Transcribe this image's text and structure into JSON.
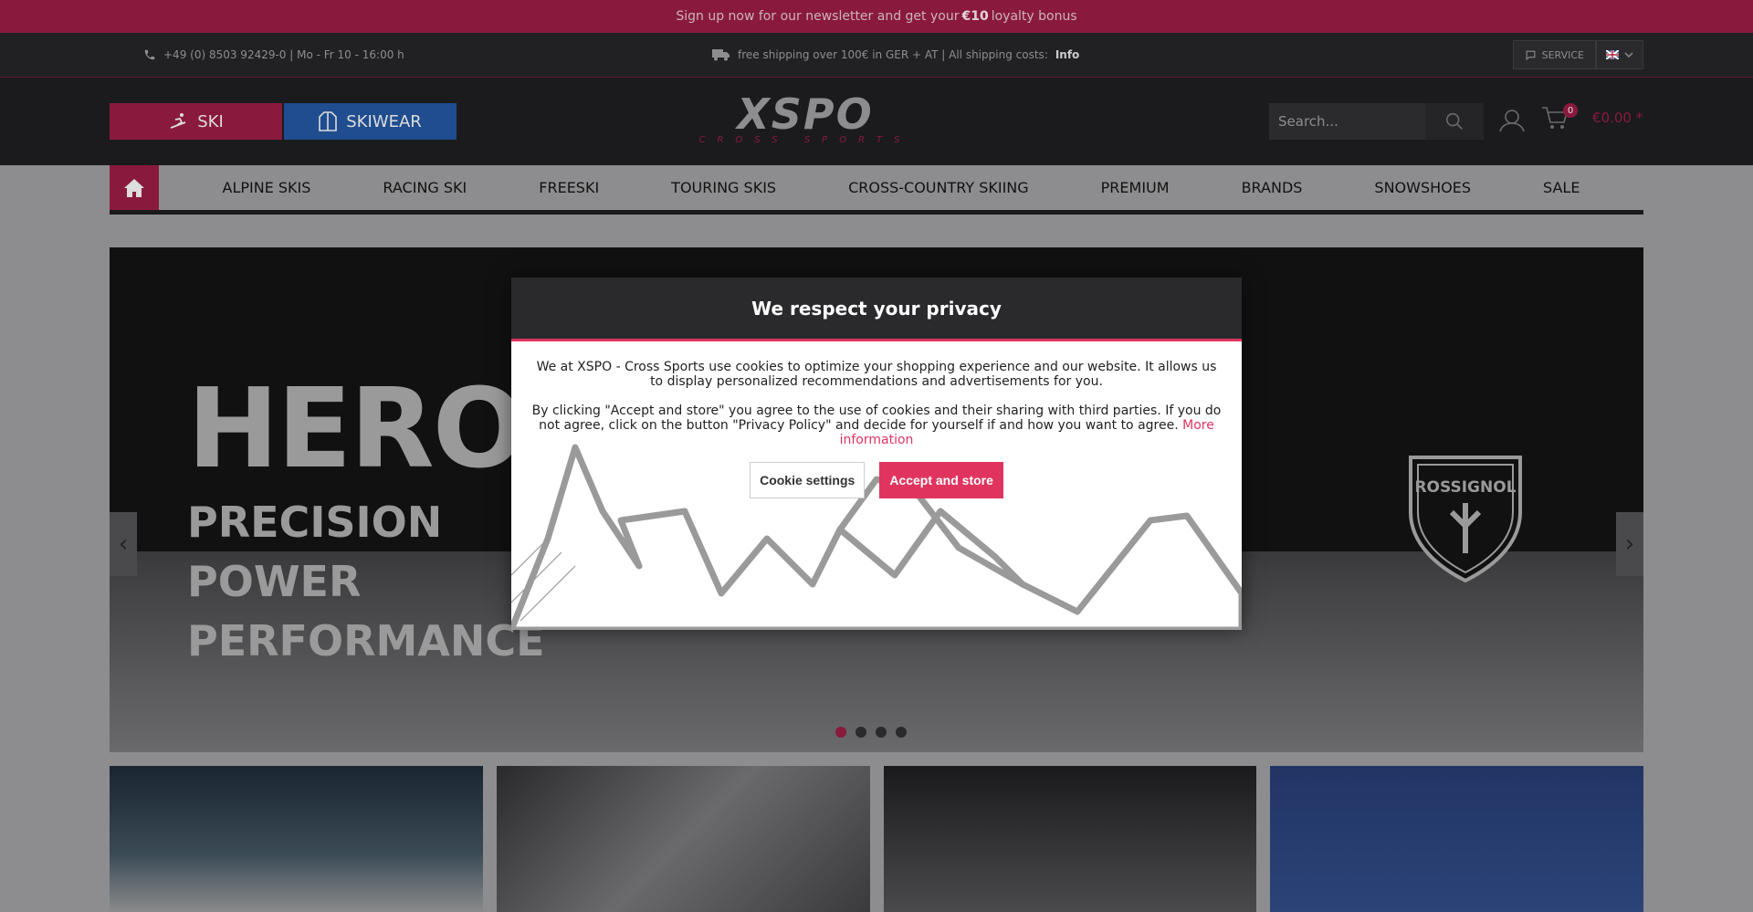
{
  "topbar": {
    "text_pre": "Sign up now for our newsletter and get your",
    "amount": "€10",
    "text_post": "loyalty bonus"
  },
  "infobar": {
    "phone": "+49 (0) 8503 92429-0 | Mo - Fr 10 - 16:00 h",
    "shipping_pre": "free shipping over 100€ in GER + AT | All shipping costs:",
    "shipping_link": "Info",
    "service": "SERVICE"
  },
  "header": {
    "cat_ski": "SKI",
    "cat_skiwear": "SKIWEAR",
    "logo_main": "XSPO",
    "logo_sub": "CROSS SPORTS",
    "search_placeholder": "Search...",
    "cart_count": "0",
    "cart_total": "€0.00 *"
  },
  "nav": [
    "ALPINE SKIS",
    "RACING SKI",
    "FREESKI",
    "TOURING SKIS",
    "CROSS-COUNTRY SKIING",
    "PREMIUM",
    "BRANDS",
    "SNOWSHOES",
    "SALE"
  ],
  "hero": {
    "title": "HERO",
    "line1": "PRECISION",
    "line2": "POWER",
    "line3": "PERFORMANCE",
    "brand": "ROSSIGNOL"
  },
  "modal": {
    "title": "We respect your privacy",
    "p1": "We at XSPO - Cross Sports use cookies to optimize your shopping experience and our website. It allows us to display personalized recommendations and advertisements for you.",
    "p2": "By clicking \"Accept and store\" you agree to the use of cookies and their sharing with third parties. If you do not agree, click on the button \"Privacy Policy\" and decide for yourself if and how you want to agree.",
    "more": "More information",
    "settings": "Cookie settings",
    "accept": "Accept and store"
  },
  "colors": {
    "accent": "#e0345f",
    "brand_dark": "#8a1a3d",
    "skiwear": "#1f4d8f"
  }
}
